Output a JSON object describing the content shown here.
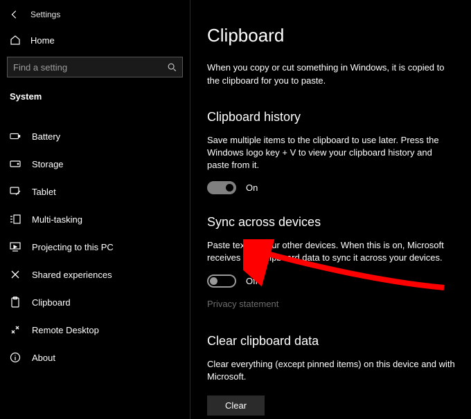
{
  "window": {
    "title": "Settings"
  },
  "sidebar": {
    "home": "Home",
    "search_placeholder": "Find a setting",
    "section": "System",
    "items": [
      {
        "label": "Battery"
      },
      {
        "label": "Storage"
      },
      {
        "label": "Tablet"
      },
      {
        "label": "Multi-tasking"
      },
      {
        "label": "Projecting to this PC"
      },
      {
        "label": "Shared experiences"
      },
      {
        "label": "Clipboard"
      },
      {
        "label": "Remote Desktop"
      },
      {
        "label": "About"
      }
    ]
  },
  "main": {
    "title": "Clipboard",
    "intro": "When you copy or cut something in Windows, it is copied to the clipboard for you to paste.",
    "history": {
      "heading": "Clipboard history",
      "desc": "Save multiple items to the clipboard to use later. Press the Windows logo key + V to view your clipboard history and paste from it.",
      "toggle_state": "On"
    },
    "sync": {
      "heading": "Sync across devices",
      "desc": "Paste text on your other devices. When this is on, Microsoft receives your clipboard data to sync it across your devices.",
      "toggle_state": "Off",
      "privacy": "Privacy statement"
    },
    "clear": {
      "heading": "Clear clipboard data",
      "desc": "Clear everything (except pinned items) on this device and with Microsoft.",
      "button": "Clear"
    }
  }
}
